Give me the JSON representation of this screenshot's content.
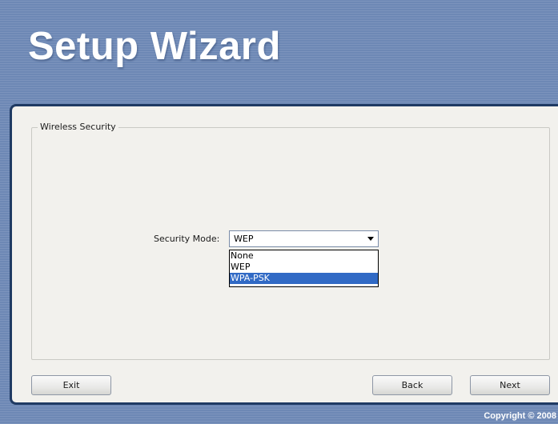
{
  "window": {
    "title": "Setup Wizard",
    "copyright": "Copyright © 2008"
  },
  "section": {
    "legend": "Wireless Security"
  },
  "security_mode": {
    "label": "Security Mode:",
    "selected_value": "WEP",
    "options": [
      "None",
      "WEP",
      "WPA-PSK"
    ],
    "highlighted_option": "WPA-PSK"
  },
  "buttons": {
    "exit": "Exit",
    "back": "Back",
    "next": "Next"
  },
  "colors": {
    "background": "#6d88b5",
    "panel_border": "#1f3a63",
    "panel": "#f2f1ed",
    "highlight": "#316ac5"
  }
}
